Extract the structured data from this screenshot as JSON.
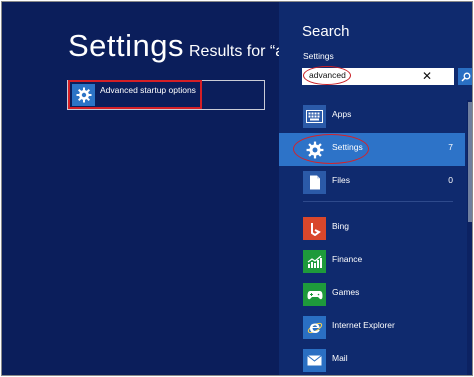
{
  "left": {
    "title": "Settings",
    "results_for": "Results for “ad",
    "result": {
      "label": "Advanced startup options",
      "icon": "gear-icon"
    }
  },
  "charm": {
    "title": "Search",
    "scope": "Settings",
    "query": "advanced",
    "clear": "✕",
    "categories": [
      {
        "label": "Apps",
        "count": "",
        "icon": "apps-icon"
      },
      {
        "label": "Settings",
        "count": "7",
        "icon": "gear-icon",
        "selected": true
      },
      {
        "label": "Files",
        "count": "0",
        "icon": "file-icon"
      }
    ],
    "apps": [
      {
        "label": "Bing",
        "icon": "bing-icon",
        "color": "#d9472b"
      },
      {
        "label": "Finance",
        "icon": "finance-icon",
        "color": "#1e9a3b"
      },
      {
        "label": "Games",
        "icon": "games-icon",
        "color": "#1e9a3b"
      },
      {
        "label": "Internet Explorer",
        "icon": "internet-explorer-icon",
        "color": "#2a6fc3"
      },
      {
        "label": "Mail",
        "icon": "mail-icon",
        "color": "#2a6fc3"
      }
    ]
  },
  "colors": {
    "background": "#0b1e5b",
    "charm": "#0f2a6e",
    "accent": "#2d73c8",
    "highlight": "#d41f26"
  }
}
